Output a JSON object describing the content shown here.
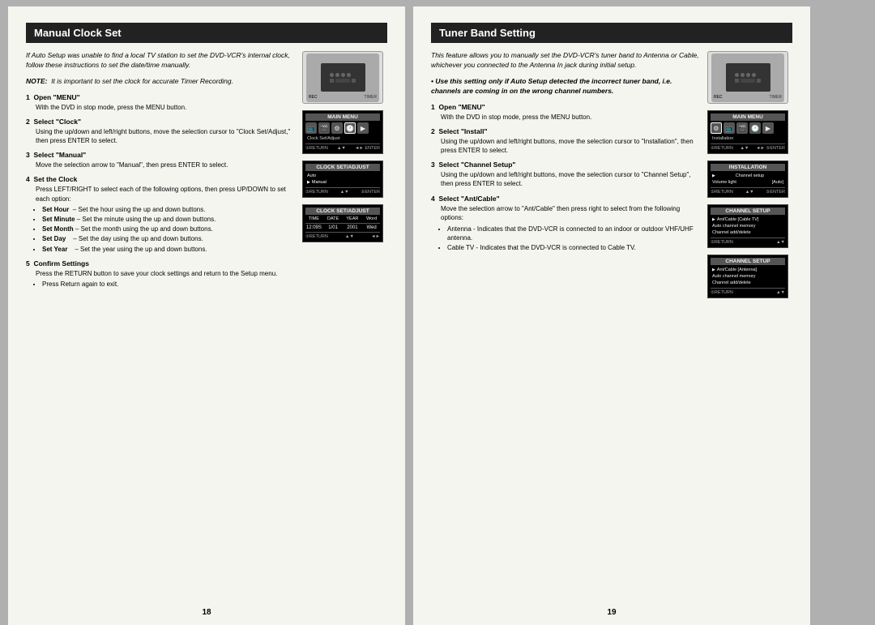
{
  "pages": {
    "left": {
      "title": "Manual Clock Set",
      "page_number": "18",
      "intro": "If Auto Setup was unable to find a local TV station to set the DVD-VCR's internal clock, follow these instructions to set the date/time manually.",
      "note": "It is important to set the clock for accurate Timer Recording.",
      "steps": [
        {
          "num": "1",
          "header": "Open \"MENU\"",
          "body": "With the DVD in stop mode, press the MENU button."
        },
        {
          "num": "2",
          "header": "Select \"Clock\"",
          "body": "Using the up/down and left/right buttons, move the selection cursor to \"Clock Set/Adjust,\" then press ENTER to select."
        },
        {
          "num": "3",
          "header": "Select \"Manual\"",
          "body": "Move the selection arrow to \"Manual\", then press ENTER to select."
        },
        {
          "num": "4",
          "header": "Set the Clock",
          "body": "Press LEFT/RIGHT to select each of the following options, then press UP/DOWN to set each option:",
          "bullets": [
            "Set Hour  – Set the hour using the up and down buttons.",
            "Set Minute – Set the minute using the up and down buttons.",
            "Set Month – Set the month using the up and down buttons.",
            "Set Day    – Set the day using the up and down buttons.",
            "Set Year    – Set the year using the up and down buttons."
          ]
        },
        {
          "num": "5",
          "header": "Confirm Settings",
          "body": "Press the RETURN button to save your clock settings and return to the Setup menu.",
          "sub_bullets": [
            "Press Return again to exit."
          ]
        }
      ],
      "screens": {
        "device": "DVD-VCR device front view",
        "main_menu": {
          "title": "MAIN MENU",
          "label": "Clock Set/Adjust",
          "bottom": "⑤RETURN  ▲▼  ◄► ENTER"
        },
        "clock_set_adjust": {
          "title": "CLOCK SET/ADJUST",
          "options": [
            "Auto",
            "Manual"
          ],
          "selected": "Manual",
          "bottom": "⑤RETURN  ▲▼  ⑤ENTER"
        },
        "clock_adjust": {
          "title": "CLOCK SET/ADJUST",
          "fields": [
            "TIME",
            "DATE",
            "YEAR",
            "Word"
          ],
          "values": [
            "12:09S",
            "1/01",
            "2001",
            "Wed"
          ],
          "bottom": "⑤RETURN  ▲▼  ◄►"
        }
      }
    },
    "right": {
      "title": "Tuner Band Setting",
      "page_number": "19",
      "intro": "This feature allows you to manually set the DVD-VCR's tuner band to Antenna or Cable, whichever you connected to the Antenna In jack during initial setup.",
      "bullet_note": "• Use this setting only if Auto Setup detected the incorrect tuner band, i.e. channels are coming in on the wrong channel numbers.",
      "steps": [
        {
          "num": "1",
          "header": "Open \"MENU\"",
          "body": "With the DVD in stop mode, press the MENU button."
        },
        {
          "num": "2",
          "header": "Select \"Install\"",
          "body": "Using the up/down and left/right buttons, move the selection cursor to \"Installation\", then press ENTER to select."
        },
        {
          "num": "3",
          "header": "Select \"Channel Setup\"",
          "body": "Using the up/down and left/right buttons, move the selection cursor to \"Channel Setup\", then press ENTER to select."
        },
        {
          "num": "4",
          "header": "Select \"Ant/Cable\"",
          "body": "Move the selection arrow to \"Ant/Cable\" then press right to select from the following options:",
          "sub_bullets": [
            "Antenna - Indicates that the DVD-VCR is connected to an indoor or outdoor VHF/UHF antenna.",
            "Cable TV - Indicates that the DVD-VCR is connected to Cable TV."
          ]
        }
      ],
      "screens": {
        "device": "DVD-VCR device front view",
        "main_menu": {
          "title": "MAIN MENU",
          "label": "Installation",
          "bottom": "⑤RETURN  ▲▼ ◄► ⑤ENTER"
        },
        "installation": {
          "title": "INSTALLATION",
          "options": [
            {
              "label": "Channel setup",
              "value": ""
            },
            {
              "label": "Volume light",
              "value": "[Auto]"
            }
          ],
          "bottom": "⑤RETURN  ▲▼  ⑤ENTER"
        },
        "channel_setup_cable": {
          "title": "CHANNEL SETUP",
          "options": [
            {
              "label": "Ant/Cable",
              "value": "[Cable TV]",
              "selected": true
            },
            {
              "label": "Auto channel memory",
              "value": ""
            },
            {
              "label": "Channel add/delete",
              "value": ""
            }
          ],
          "bottom": "⑤RETURN  ▲▼"
        },
        "channel_setup_antenna": {
          "title": "CHANNEL SETUP",
          "options": [
            {
              "label": "Ant/Cable",
              "value": "[Antenna]",
              "selected": true
            },
            {
              "label": "Auto channel memory",
              "value": ""
            },
            {
              "label": "Channel add/delete",
              "value": ""
            }
          ],
          "bottom": "⑤RETURN  ▲▼"
        }
      }
    }
  }
}
